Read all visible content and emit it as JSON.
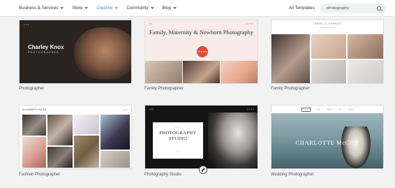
{
  "nav": {
    "items": [
      {
        "label": "Business & Services",
        "active": false
      },
      {
        "label": "Store",
        "active": false
      },
      {
        "label": "Creative",
        "active": true
      },
      {
        "label": "Community",
        "active": false
      },
      {
        "label": "Blog",
        "active": false
      }
    ],
    "all_templates": "All Templates",
    "search_value": "photography"
  },
  "colors": {
    "accent": "#3a8ee6",
    "cta": "#e04a30"
  },
  "cards": [
    {
      "label": "Photographer",
      "thumb": {
        "name": "Charley Knox",
        "sub": "PHOTOGRAPHER"
      }
    },
    {
      "label": "Family Photographer",
      "thumb": {
        "title": "Family, Maternity & Newborn Photography",
        "button": "Book Now"
      }
    },
    {
      "label": "Family Photographer",
      "thumb": {
        "header": "ISABELLA GUMMEN"
      }
    },
    {
      "label": "Fashion Photographer",
      "thumb": {
        "header": "ELIZABETH BACH"
      }
    },
    {
      "label": "Photography Studio",
      "thumb": {
        "studio": "PHOTOGRAPHY STUDIO"
      }
    },
    {
      "label": "Wedding Photographer",
      "thumb": {
        "title": "CHARLOTTE McCOY"
      }
    }
  ]
}
